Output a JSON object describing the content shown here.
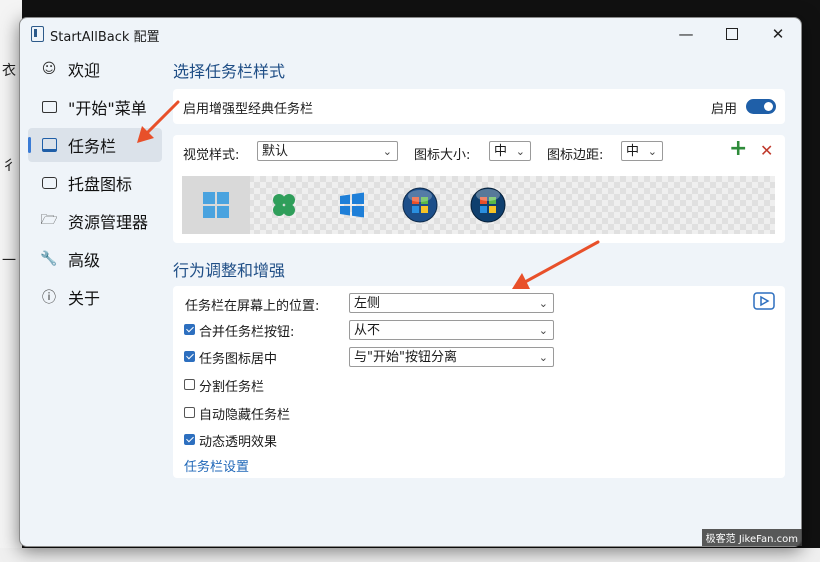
{
  "window": {
    "title": "StartAllBack 配置"
  },
  "sidebar": {
    "items": [
      {
        "label": "欢迎"
      },
      {
        "label": "\"开始\"菜单"
      },
      {
        "label": "任务栏"
      },
      {
        "label": "托盘图标"
      },
      {
        "label": "资源管理器"
      },
      {
        "label": "高级"
      },
      {
        "label": "关于"
      }
    ],
    "active_index": 2
  },
  "style_section": {
    "heading": "选择任务栏样式",
    "enhanced_label": "启用增强型经典任务栏",
    "enable_label": "启用",
    "enabled": true,
    "visual_style_label": "视觉样式:",
    "visual_style_value": "默认",
    "icon_size_label": "图标大小:",
    "icon_size_value": "中",
    "icon_margin_label": "图标边距:",
    "icon_margin_value": "中",
    "add_glyph": "+",
    "delete_glyph": "✕",
    "style_tiles": [
      "windows11-icon",
      "clover-icon",
      "windows10-icon",
      "windows7-orb-icon",
      "windows-vista-orb-icon"
    ],
    "selected_tile": 0
  },
  "behavior_section": {
    "heading": "行为调整和增强",
    "position_label": "任务栏在屏幕上的位置:",
    "position_value": "左侧",
    "combine_label": "合并任务栏按钮:",
    "combine_value": "从不",
    "combine_checked": true,
    "center_label": "任务图标居中",
    "center_value": "与\"开始\"按钮分离",
    "center_checked": true,
    "split_label": "分割任务栏",
    "split_checked": false,
    "autohide_label": "自动隐藏任务栏",
    "autohide_checked": false,
    "transparency_label": "动态透明效果",
    "transparency_checked": true,
    "settings_link": "任务栏设置"
  },
  "watermark": "极客范 JikeFan.com",
  "colors": {
    "accent": "#1f5fa8",
    "heading": "#1f4e86",
    "arrow": "#e8502a"
  }
}
